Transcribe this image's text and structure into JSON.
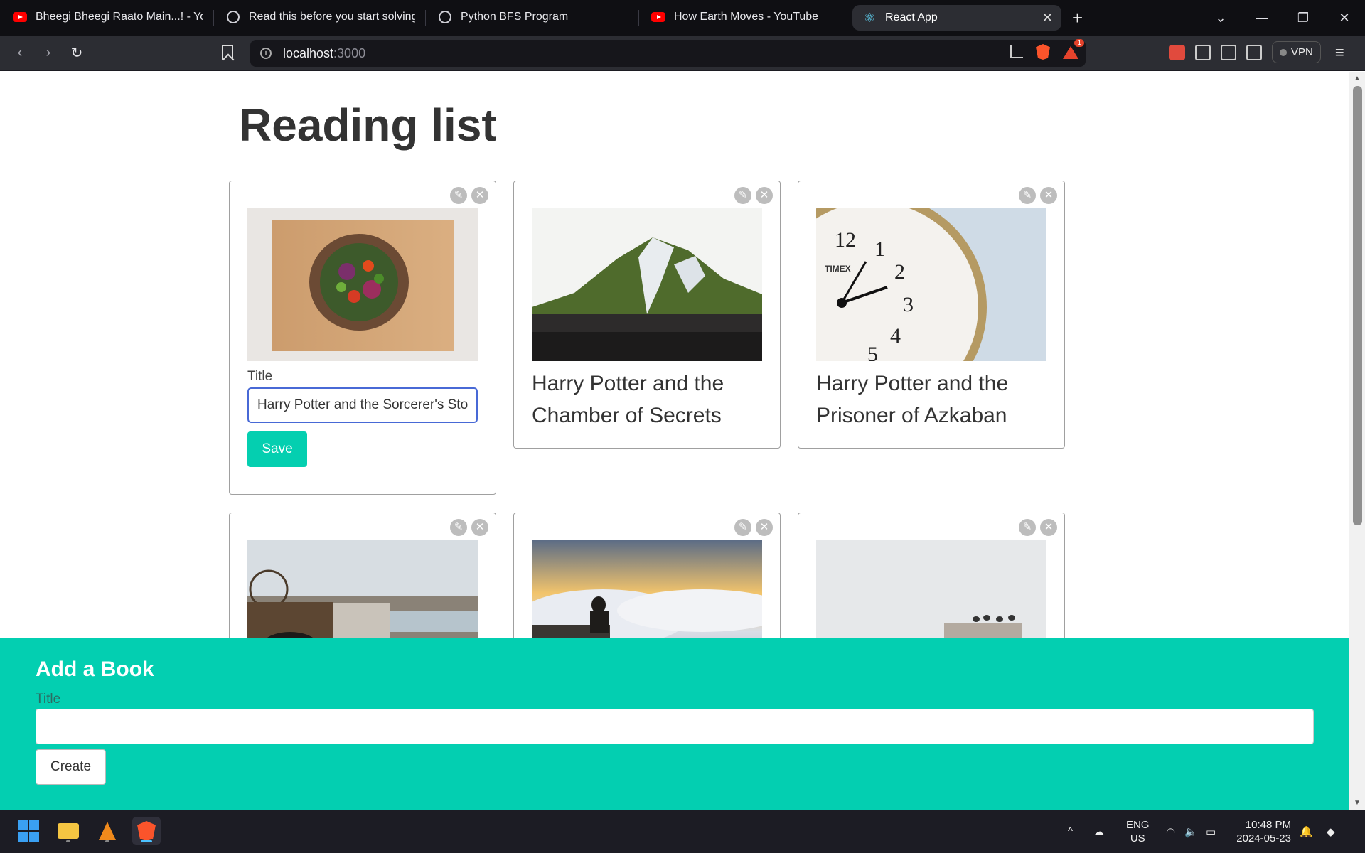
{
  "browser": {
    "tabs": [
      {
        "title": "Bheegi Bheegi Raato Main...! - YouTu",
        "favicon": "youtube-icon",
        "active": false
      },
      {
        "title": "Read this before you start solving pr",
        "favicon": "ring-icon",
        "active": false
      },
      {
        "title": "Python BFS Program",
        "favicon": "openai-icon",
        "active": false
      },
      {
        "title": "How Earth Moves - YouTube",
        "favicon": "youtube-icon",
        "active": false
      },
      {
        "title": "React App",
        "favicon": "react-icon",
        "active": true
      }
    ],
    "url_host": "localhost",
    "url_port": ":3000",
    "notification_badge": "1",
    "vpn_label": "VPN"
  },
  "page": {
    "heading": "Reading list",
    "books": [
      {
        "title": "",
        "editing": true,
        "edit_label": "Title",
        "edit_value": "Harry Potter and the Sorcerer's Stone",
        "save_label": "Save",
        "image": "salad-bowl"
      },
      {
        "title": "Harry Potter and the Chamber of Secrets",
        "image": "mountain"
      },
      {
        "title": "Harry Potter and the Prisoner of Azkaban",
        "image": "clock"
      },
      {
        "title": "",
        "image": "boardwalk"
      },
      {
        "title": "",
        "image": "clouds"
      },
      {
        "title": "",
        "image": "birds-wall"
      }
    ],
    "card_icons": {
      "edit": "pencil-icon",
      "delete": "close-icon"
    }
  },
  "add_book": {
    "title": "Add a Book",
    "label": "Title",
    "value": "",
    "button_label": "Create"
  },
  "taskbar": {
    "language": "ENG",
    "region": "US",
    "time": "10:48 PM",
    "date": "2024-05-23"
  },
  "colors": {
    "accent": "#03cfb1",
    "input_focus": "#4869d6",
    "heading": "#333333"
  }
}
